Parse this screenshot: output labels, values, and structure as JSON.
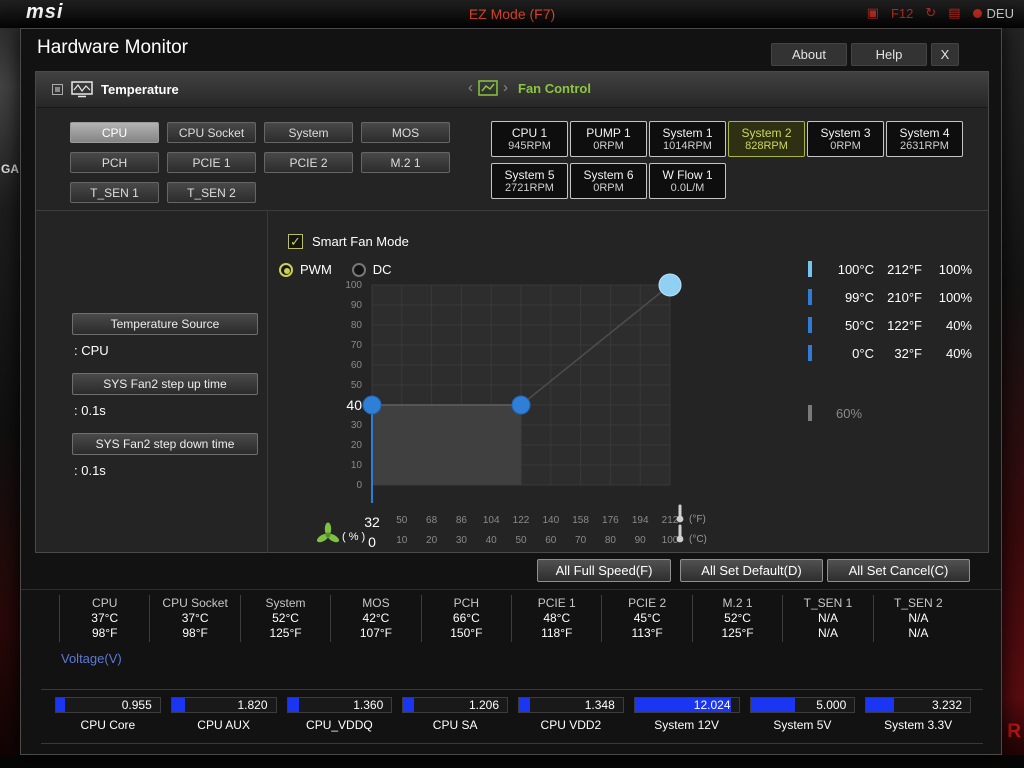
{
  "background": {
    "logo": "msi",
    "ez_mode": "EZ Mode (F7)",
    "top_icons": [
      {
        "glyph": "▣"
      },
      {
        "glyph": "F12"
      },
      {
        "glyph": "↻"
      },
      {
        "glyph": "▤"
      }
    ],
    "lang": "DEU",
    "left_text": "GA",
    "corner_text": "R"
  },
  "icons": {
    "window": "window-icon",
    "temperature_graph": "temperature-graph-icon",
    "fan_chart": "fan-chart-icon",
    "fan": "fan-icon",
    "thermometer": "thermometer-icon",
    "checkmark": "checkmark-icon",
    "radio": "radio-icon",
    "language_dot": "language-dot-icon"
  },
  "window": {
    "title": "Hardware Monitor",
    "about": "About",
    "help": "Help",
    "close": "X"
  },
  "tabs": {
    "temperature": "Temperature",
    "fan_control": "Fan Control"
  },
  "temp_sources": [
    {
      "label": "CPU",
      "selected": true
    },
    {
      "label": "CPU Socket"
    },
    {
      "label": "System"
    },
    {
      "label": "MOS"
    },
    {
      "label": "PCH"
    },
    {
      "label": "PCIE 1"
    },
    {
      "label": "PCIE 2"
    },
    {
      "label": "M.2 1"
    },
    {
      "label": "T_SEN 1"
    },
    {
      "label": "T_SEN 2"
    }
  ],
  "fans": [
    {
      "name": "CPU 1",
      "value": "945RPM"
    },
    {
      "name": "PUMP 1",
      "value": "0RPM"
    },
    {
      "name": "System 1",
      "value": "1014RPM"
    },
    {
      "name": "System 2",
      "value": "828RPM",
      "selected": true
    },
    {
      "name": "System 3",
      "value": "0RPM"
    },
    {
      "name": "System 4",
      "value": "2631RPM"
    },
    {
      "name": "System 5",
      "value": "2721RPM"
    },
    {
      "name": "System 6",
      "value": "0RPM"
    },
    {
      "name": "W Flow 1",
      "value": "0.0L/M"
    }
  ],
  "smart_fan": {
    "label": "Smart Fan Mode",
    "check": "✓",
    "checked": true
  },
  "left_panel": {
    "pwm": "PWM",
    "dc": "DC",
    "fields": [
      {
        "button": "Temperature Source",
        "value": ": CPU"
      },
      {
        "button": "SYS Fan2 step up time",
        "value": ": 0.1s"
      },
      {
        "button": "SYS Fan2 step down time",
        "value": ": 0.1s"
      }
    ]
  },
  "chart_data": {
    "type": "line",
    "xlim": [
      0,
      100
    ],
    "ylim": [
      0,
      100
    ],
    "grid": true,
    "y_ticks": [
      "100",
      "90",
      "80",
      "70",
      "60",
      "50",
      "40",
      "30",
      "20",
      "10",
      "0"
    ],
    "x_ticks_f": [
      "32",
      "50",
      "68",
      "86",
      "104",
      "122",
      "140",
      "158",
      "176",
      "194",
      "212"
    ],
    "x_ticks_c": [
      "0",
      "10",
      "20",
      "30",
      "40",
      "50",
      "60",
      "70",
      "80",
      "90",
      "100"
    ],
    "current": {
      "y": "40",
      "xf": "32",
      "xc": "0"
    },
    "points": [
      {
        "x": 0,
        "y": 40,
        "color": "#2f7fd6",
        "rim": "#1e66b4",
        "r": 9
      },
      {
        "x": 50,
        "y": 40,
        "color": "#2f7fd6",
        "rim": "#1e66b4",
        "r": 9
      },
      {
        "x": 100,
        "y": 100,
        "color": "#8fd0f3",
        "rim": "#bce3fa",
        "r": 11
      }
    ],
    "percent_label": "( % )",
    "unit_f": "(°F)",
    "unit_c": "(°C)",
    "colors": {
      "plot_bg": "#2d2d2d",
      "grid": "#393939",
      "fill_area": "#404040",
      "curve_line": "#2e7cd6",
      "accent": "#cdd14e"
    }
  },
  "legend": {
    "rows": [
      {
        "c": "100°C",
        "f": "212°F",
        "p": "100%",
        "bar": "#74c6ee"
      },
      {
        "c": "99°C",
        "f": "210°F",
        "p": "100%",
        "bar": "#2e7cd6"
      },
      {
        "c": "50°C",
        "f": "122°F",
        "p": "40%",
        "bar": "#2e7cd6"
      },
      {
        "c": "0°C",
        "f": "32°F",
        "p": "40%",
        "bar": "#2e7cd6"
      }
    ],
    "extra": {
      "p": "60%",
      "bar": "#7a7a7a"
    }
  },
  "actions": [
    "All Full Speed(F)",
    "All Set Default(D)",
    "All Set Cancel(C)"
  ],
  "temps": [
    {
      "name": "CPU",
      "c": "37°C",
      "f": "98°F"
    },
    {
      "name": "CPU Socket",
      "c": "37°C",
      "f": "98°F"
    },
    {
      "name": "System",
      "c": "52°C",
      "f": "125°F"
    },
    {
      "name": "MOS",
      "c": "42°C",
      "f": "107°F"
    },
    {
      "name": "PCH",
      "c": "66°C",
      "f": "150°F"
    },
    {
      "name": "PCIE 1",
      "c": "48°C",
      "f": "118°F"
    },
    {
      "name": "PCIE 2",
      "c": "45°C",
      "f": "113°F"
    },
    {
      "name": "M.2 1",
      "c": "52°C",
      "f": "125°F"
    },
    {
      "name": "T_SEN 1",
      "c": "N/A",
      "f": "N/A"
    },
    {
      "name": "T_SEN 2",
      "c": "N/A",
      "f": "N/A"
    }
  ],
  "voltage": {
    "label": "Voltage(V)",
    "bar_color": "#1b36f2",
    "items": [
      {
        "name": "CPU Core",
        "value": "0.955",
        "fill": 9
      },
      {
        "name": "CPU AUX",
        "value": "1.820",
        "fill": 13
      },
      {
        "name": "CPU_VDDQ",
        "value": "1.360",
        "fill": 11
      },
      {
        "name": "CPU SA",
        "value": "1.206",
        "fill": 10
      },
      {
        "name": "CPU VDD2",
        "value": "1.348",
        "fill": 11
      },
      {
        "name": "System 12V",
        "value": "12.024",
        "fill": 93
      },
      {
        "name": "System 5V",
        "value": "5.000",
        "fill": 43
      },
      {
        "name": "System 3.3V",
        "value": "3.232",
        "fill": 27
      }
    ]
  }
}
